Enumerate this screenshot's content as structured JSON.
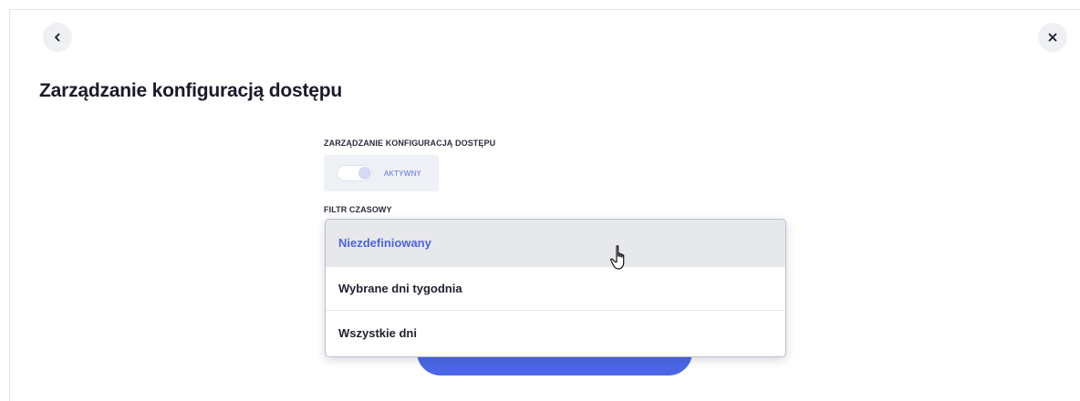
{
  "header": {
    "title": "Zarządzanie konfiguracją dostępu",
    "back_icon": "chevron-left-icon",
    "close_icon": "close-icon"
  },
  "access_config": {
    "label": "ZARZĄDZANIE KONFIGURACJĄ DOSTĘPU",
    "toggle_state": "on",
    "toggle_label": "AKTYWNY"
  },
  "time_filter": {
    "label": "FILTR CZASOWY",
    "selected_value": "Niezdefiniowany",
    "options": [
      "Niezdefiniowany",
      "Wybrane dni tygodnia",
      "Wszystkie dni"
    ]
  },
  "colors": {
    "accent": "#4a66e6",
    "selected_option_text": "#4b63e0",
    "toggle_label": "#5b6ee8"
  }
}
